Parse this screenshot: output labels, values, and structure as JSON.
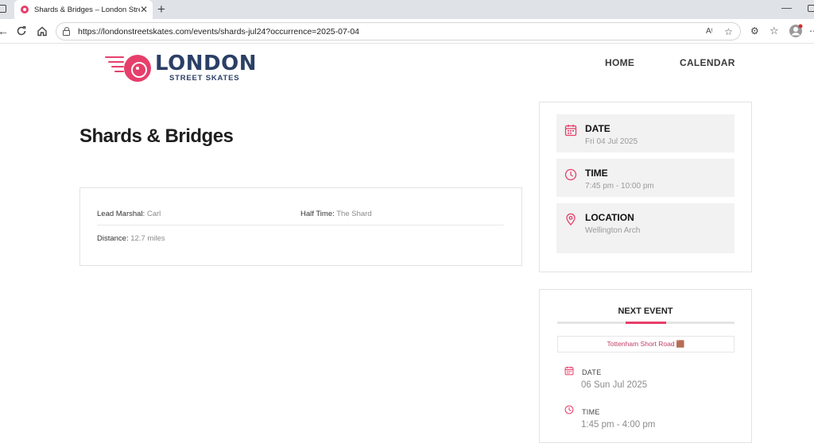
{
  "browser": {
    "tab_title": "Shards & Bridges – London Street",
    "url": "https://londonstreetskates.com/events/shards-jul24?occurrence=2025-07-04"
  },
  "site": {
    "logo_word": "LONDON",
    "logo_sub": "STREET SKATES",
    "nav": [
      "HOME",
      "CALENDAR"
    ]
  },
  "event": {
    "title": "Shards & Bridges",
    "details": {
      "lead_marshal_label": "Lead Marshal:",
      "lead_marshal": "Carl",
      "half_time_label": "Half Time:",
      "half_time": "The Shard",
      "distance_label": "Distance:",
      "distance": "12.7 miles"
    }
  },
  "sidebar": {
    "date_label": "DATE",
    "date_value": "Fri 04 Jul 2025",
    "time_label": "TIME",
    "time_value": "7:45 pm - 10:00 pm",
    "location_label": "LOCATION",
    "location_value": "Wellington Arch"
  },
  "next_event": {
    "heading": "NEXT EVENT",
    "link_text": "Tottenham Short Road 🟫",
    "date_label": "DATE",
    "date_value": "06 Sun Jul 2025",
    "time_label": "TIME",
    "time_value": "1:45 pm - 4:00 pm"
  },
  "colors": {
    "accent": "#e63f6b",
    "brand_navy": "#2b3f66"
  },
  "icons": {
    "date": "calendar-icon",
    "time": "clock-icon",
    "location": "map-pin-icon"
  }
}
